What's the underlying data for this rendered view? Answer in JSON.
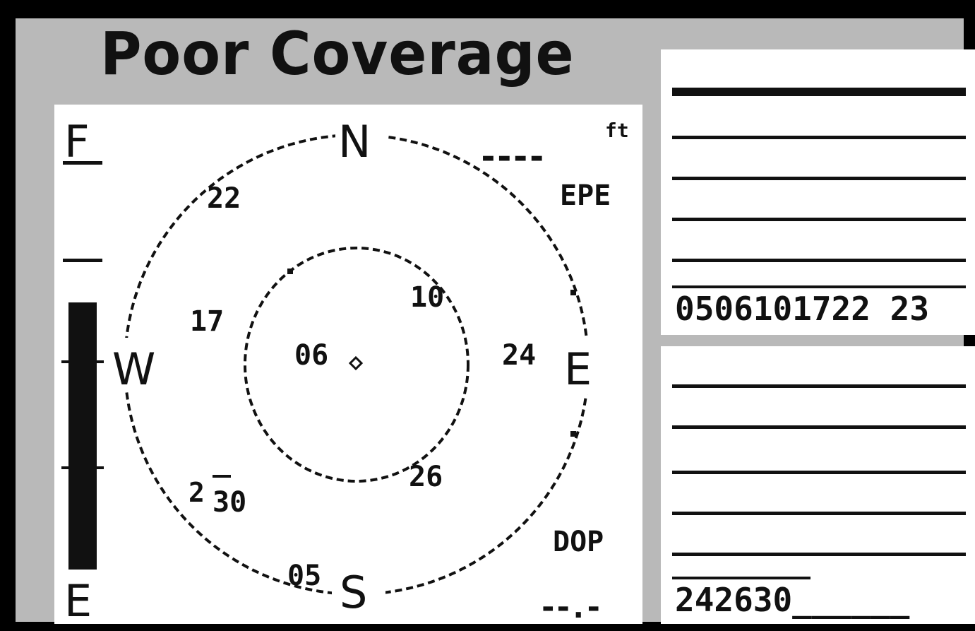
{
  "title": "Poor Coverage",
  "skyview": {
    "cardinals": {
      "north": "N",
      "east": "E",
      "south": "S",
      "west": "W"
    },
    "elevation_bar": {
      "top_label": "F",
      "bottom_label": "E"
    },
    "satellites": [
      {
        "id": "22"
      },
      {
        "id": "17"
      },
      {
        "id": "10"
      },
      {
        "id": "06"
      },
      {
        "id": "24"
      },
      {
        "id": "26"
      },
      {
        "id": "2"
      },
      {
        "id": "30"
      },
      {
        "id": "05"
      }
    ],
    "epe": {
      "label": "EPE",
      "value": "----",
      "unit": "ft"
    },
    "dop": {
      "label": "DOP",
      "value": "--.-"
    }
  },
  "signal_panel_top": {
    "satellite_ids": "0506101722 23"
  },
  "signal_panel_bottom": {
    "satellite_ids": "242630______"
  }
}
